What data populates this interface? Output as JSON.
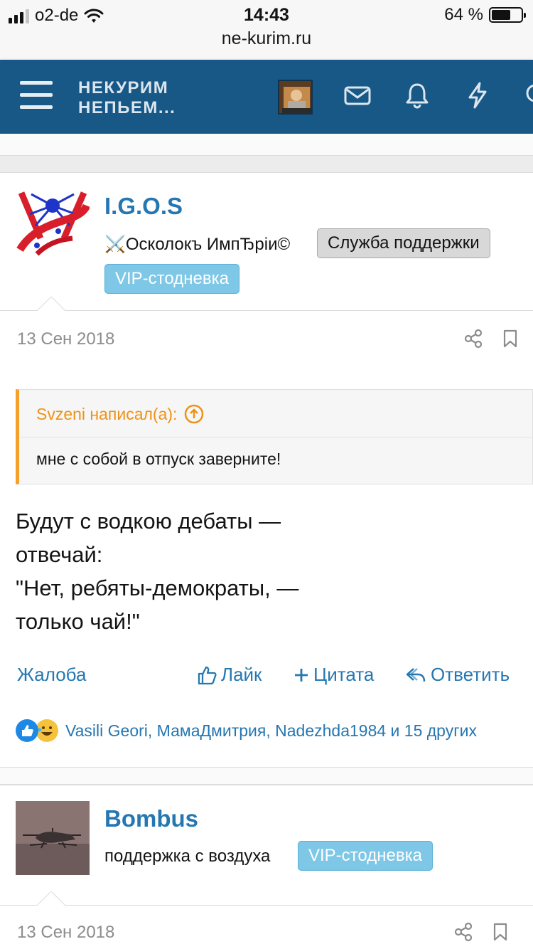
{
  "status_bar": {
    "carrier": "o2-de",
    "time": "14:43",
    "battery": "64 %",
    "battery_level": 0.64,
    "url": "ne-kurim.ru"
  },
  "header": {
    "logo_line1": "НЕКУРИМ",
    "logo_line2": "НЕПЬЕМ...",
    "icons": [
      "menu-icon",
      "mail-icon",
      "bell-icon",
      "bolt-icon",
      "search-icon"
    ]
  },
  "posts": [
    {
      "username": "I.G.O.S",
      "user_title": "⚔️Осколокъ ИмпЂрiи©",
      "badges": [
        "Служба поддержки",
        "VIP-стодневка"
      ],
      "date": "13 Сен 2018",
      "quote": {
        "author_line": "Svzeni написал(а):",
        "text": "мне с собой в отпуск заверните!"
      },
      "text": "Будут с водкою дебаты —\nотвечай:\n\"Нет, ребяты-демократы, —\nтолько чай!\"",
      "actions": {
        "report": "Жалоба",
        "like": "Лайк",
        "quote": "Цитата",
        "reply": "Ответить"
      },
      "reactions_text": "Vasili Geori, МамаДмитрия, Nadezhda1984 и 15 других"
    },
    {
      "username": "Bombus",
      "user_title": "поддержка с воздуха",
      "badges": [
        "VIP-стодневка"
      ],
      "date": "13 Сен 2018"
    }
  ],
  "colors": {
    "header_bg": "#185886",
    "link": "#2577b1",
    "quote_accent": "#f5a02a",
    "vip_badge": "#7ec7e6"
  }
}
